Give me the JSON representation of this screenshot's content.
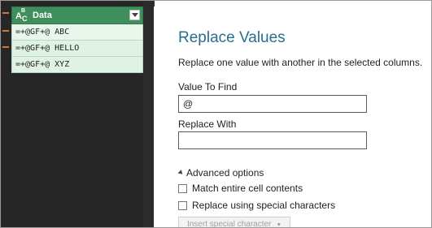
{
  "table": {
    "column_name": "Data",
    "column_type_icon": "text-type-icon",
    "rows": [
      "=+@GF+@ ABC",
      "=+@GF+@ HELLO",
      "=+@GF+@ XYZ"
    ]
  },
  "dialog": {
    "title": "Replace Values",
    "description": "Replace one value with another in the selected columns.",
    "value_to_find": {
      "label": "Value To Find",
      "value": "@"
    },
    "replace_with": {
      "label": "Replace With",
      "value": ""
    },
    "advanced_options_label": "Advanced options",
    "match_entire_label": "Match entire cell contents",
    "special_chars_label": "Replace using special characters",
    "insert_special_label": "Insert special character"
  },
  "colors": {
    "header_green": "#3f8f5d",
    "row_green": "#dff2e3",
    "title_blue": "#2a6d8f"
  }
}
